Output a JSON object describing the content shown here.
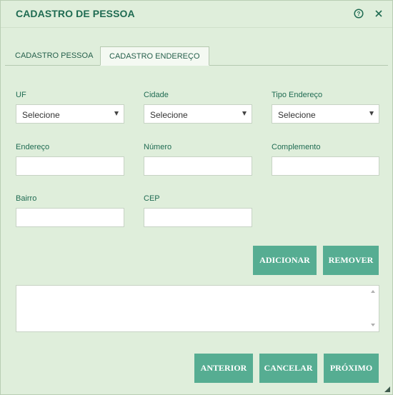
{
  "dialog": {
    "title": "CADASTRO DE PESSOA",
    "help_icon": "help-circle-icon",
    "close_icon": "close-icon"
  },
  "tabs": [
    {
      "label": "CADASTRO PESSOA",
      "active": false
    },
    {
      "label": "CADASTRO ENDEREÇO",
      "active": true
    }
  ],
  "form": {
    "uf": {
      "label": "UF",
      "value": "Selecione"
    },
    "cidade": {
      "label": "Cidade",
      "value": "Selecione"
    },
    "tipo_endereco": {
      "label": "Tipo Endereço",
      "value": "Selecione"
    },
    "endereco": {
      "label": "Endereço",
      "value": ""
    },
    "numero": {
      "label": "Número",
      "value": ""
    },
    "complemento": {
      "label": "Complemento",
      "value": ""
    },
    "bairro": {
      "label": "Bairro",
      "value": ""
    },
    "cep": {
      "label": "CEP",
      "value": ""
    }
  },
  "actions": {
    "add": "ADICIONAR",
    "remove": "REMOVER"
  },
  "address_list": [],
  "footer": {
    "previous": "ANTERIOR",
    "cancel": "CANCELAR",
    "next": "PRÓXIMO"
  },
  "colors": {
    "background": "#dfeedb",
    "accent": "#56ad92",
    "title": "#1f6b52"
  }
}
